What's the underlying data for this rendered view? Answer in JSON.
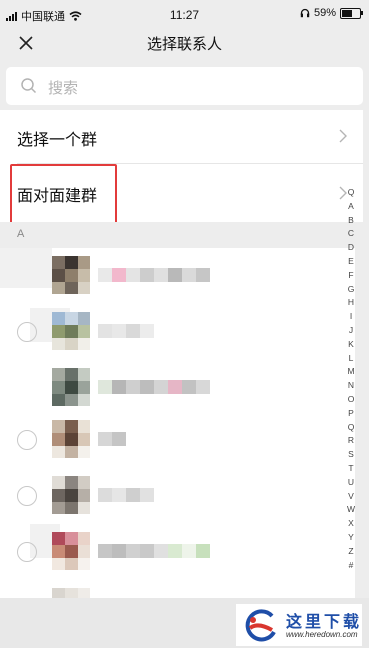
{
  "status_bar": {
    "carrier": "中国联通",
    "time": "11:27",
    "battery_percent_label": "59%",
    "battery_level": 0.59
  },
  "nav": {
    "title": "选择联系人",
    "close_icon": "close-icon"
  },
  "search": {
    "placeholder": "搜索",
    "icon": "search-icon"
  },
  "menu": {
    "select_group_label": "选择一个群",
    "face_to_face_label": "面对面建群"
  },
  "section": {
    "letter": "A"
  },
  "index_bar": [
    "Q",
    "A",
    "B",
    "C",
    "D",
    "E",
    "F",
    "G",
    "H",
    "I",
    "J",
    "K",
    "L",
    "M",
    "N",
    "O",
    "P",
    "Q",
    "R",
    "S",
    "T",
    "U",
    "V",
    "W",
    "X",
    "Y",
    "Z",
    "#"
  ],
  "colors": {
    "highlight_border": "#e23b3b",
    "background": "#ededed",
    "brand_blue": "#1f4ea8"
  },
  "watermark": {
    "title": "这里下载",
    "url": "www.heredown.com"
  }
}
